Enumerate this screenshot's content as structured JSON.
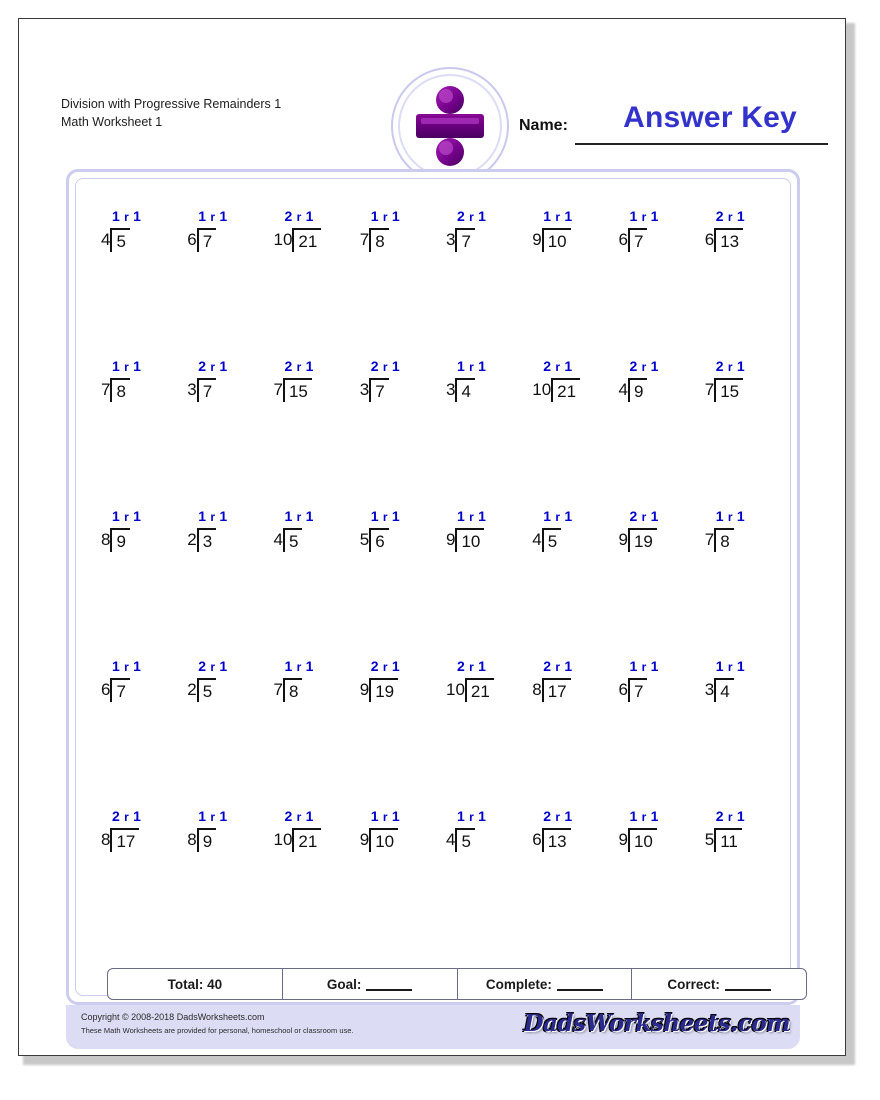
{
  "document": {
    "title_line_1": "Division with Progressive Remainders 1",
    "title_line_2": "Math Worksheet 1"
  },
  "header": {
    "name_label": "Name:",
    "name_value": "Answer Key",
    "logo_icon": "division-symbol-icon",
    "answer_key_color": "#3333cc"
  },
  "problems": [
    [
      {
        "divisor": "4",
        "dividend": "5",
        "quotient": "1",
        "remainder": "1"
      },
      {
        "divisor": "6",
        "dividend": "7",
        "quotient": "1",
        "remainder": "1"
      },
      {
        "divisor": "10",
        "dividend": "21",
        "quotient": "2",
        "remainder": "1"
      },
      {
        "divisor": "7",
        "dividend": "8",
        "quotient": "1",
        "remainder": "1"
      },
      {
        "divisor": "3",
        "dividend": "7",
        "quotient": "2",
        "remainder": "1"
      },
      {
        "divisor": "9",
        "dividend": "10",
        "quotient": "1",
        "remainder": "1"
      },
      {
        "divisor": "6",
        "dividend": "7",
        "quotient": "1",
        "remainder": "1"
      },
      {
        "divisor": "6",
        "dividend": "13",
        "quotient": "2",
        "remainder": "1"
      }
    ],
    [
      {
        "divisor": "7",
        "dividend": "8",
        "quotient": "1",
        "remainder": "1"
      },
      {
        "divisor": "3",
        "dividend": "7",
        "quotient": "2",
        "remainder": "1"
      },
      {
        "divisor": "7",
        "dividend": "15",
        "quotient": "2",
        "remainder": "1"
      },
      {
        "divisor": "3",
        "dividend": "7",
        "quotient": "2",
        "remainder": "1"
      },
      {
        "divisor": "3",
        "dividend": "4",
        "quotient": "1",
        "remainder": "1"
      },
      {
        "divisor": "10",
        "dividend": "21",
        "quotient": "2",
        "remainder": "1"
      },
      {
        "divisor": "4",
        "dividend": "9",
        "quotient": "2",
        "remainder": "1"
      },
      {
        "divisor": "7",
        "dividend": "15",
        "quotient": "2",
        "remainder": "1"
      }
    ],
    [
      {
        "divisor": "8",
        "dividend": "9",
        "quotient": "1",
        "remainder": "1"
      },
      {
        "divisor": "2",
        "dividend": "3",
        "quotient": "1",
        "remainder": "1"
      },
      {
        "divisor": "4",
        "dividend": "5",
        "quotient": "1",
        "remainder": "1"
      },
      {
        "divisor": "5",
        "dividend": "6",
        "quotient": "1",
        "remainder": "1"
      },
      {
        "divisor": "9",
        "dividend": "10",
        "quotient": "1",
        "remainder": "1"
      },
      {
        "divisor": "4",
        "dividend": "5",
        "quotient": "1",
        "remainder": "1"
      },
      {
        "divisor": "9",
        "dividend": "19",
        "quotient": "2",
        "remainder": "1"
      },
      {
        "divisor": "7",
        "dividend": "8",
        "quotient": "1",
        "remainder": "1"
      }
    ],
    [
      {
        "divisor": "6",
        "dividend": "7",
        "quotient": "1",
        "remainder": "1"
      },
      {
        "divisor": "2",
        "dividend": "5",
        "quotient": "2",
        "remainder": "1"
      },
      {
        "divisor": "7",
        "dividend": "8",
        "quotient": "1",
        "remainder": "1"
      },
      {
        "divisor": "9",
        "dividend": "19",
        "quotient": "2",
        "remainder": "1"
      },
      {
        "divisor": "10",
        "dividend": "21",
        "quotient": "2",
        "remainder": "1"
      },
      {
        "divisor": "8",
        "dividend": "17",
        "quotient": "2",
        "remainder": "1"
      },
      {
        "divisor": "6",
        "dividend": "7",
        "quotient": "1",
        "remainder": "1"
      },
      {
        "divisor": "3",
        "dividend": "4",
        "quotient": "1",
        "remainder": "1"
      }
    ],
    [
      {
        "divisor": "8",
        "dividend": "17",
        "quotient": "2",
        "remainder": "1"
      },
      {
        "divisor": "8",
        "dividend": "9",
        "quotient": "1",
        "remainder": "1"
      },
      {
        "divisor": "10",
        "dividend": "21",
        "quotient": "2",
        "remainder": "1"
      },
      {
        "divisor": "9",
        "dividend": "10",
        "quotient": "1",
        "remainder": "1"
      },
      {
        "divisor": "4",
        "dividend": "5",
        "quotient": "1",
        "remainder": "1"
      },
      {
        "divisor": "6",
        "dividend": "13",
        "quotient": "2",
        "remainder": "1"
      },
      {
        "divisor": "9",
        "dividend": "10",
        "quotient": "1",
        "remainder": "1"
      },
      {
        "divisor": "5",
        "dividend": "11",
        "quotient": "2",
        "remainder": "1"
      }
    ]
  ],
  "score_bar": {
    "total_label": "Total: 40",
    "goal_label": "Goal:",
    "complete_label": "Complete:",
    "correct_label": "Correct:"
  },
  "footer": {
    "copyright": "Copyright © 2008-2018 DadsWorksheets.com",
    "usage": "These Math Worksheets are provided for personal, homeschool or classroom use.",
    "brand": "DadsWorksheets.com"
  }
}
